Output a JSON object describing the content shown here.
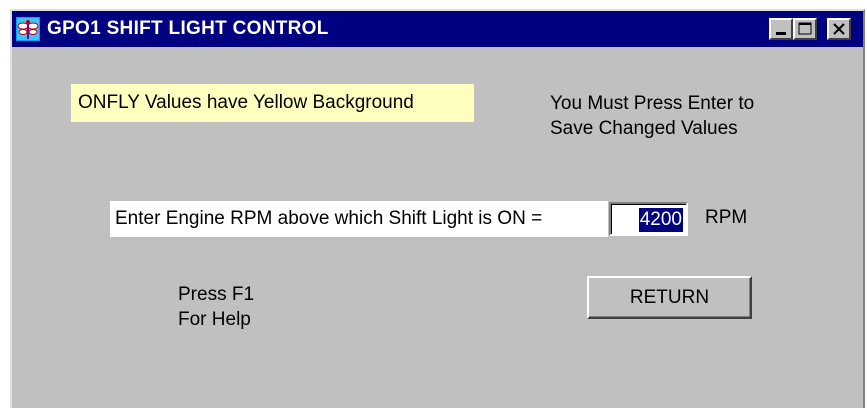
{
  "window": {
    "title": "GPO1 SHIFT LIGHT CONTROL",
    "app_icon": "dragonfly-icon",
    "controls": [
      "minimize-icon",
      "maximize-icon",
      "close-icon"
    ]
  },
  "notes": {
    "onfly": "ONFLY Values have Yellow Background",
    "must_press_line1": "You Must Press Enter to",
    "must_press_line2": "Save Changed Values"
  },
  "rpm": {
    "prompt": "Enter Engine RPM above which Shift Light is ON =",
    "value": "4200",
    "unit": "RPM"
  },
  "help": {
    "line1": "Press F1",
    "line2": "For Help"
  },
  "buttons": {
    "return_label": "RETURN"
  },
  "colors": {
    "titlebar": "#000080",
    "face": "#c0c0c0",
    "onfly_background": "#ffffc0",
    "selection": "#000080"
  }
}
